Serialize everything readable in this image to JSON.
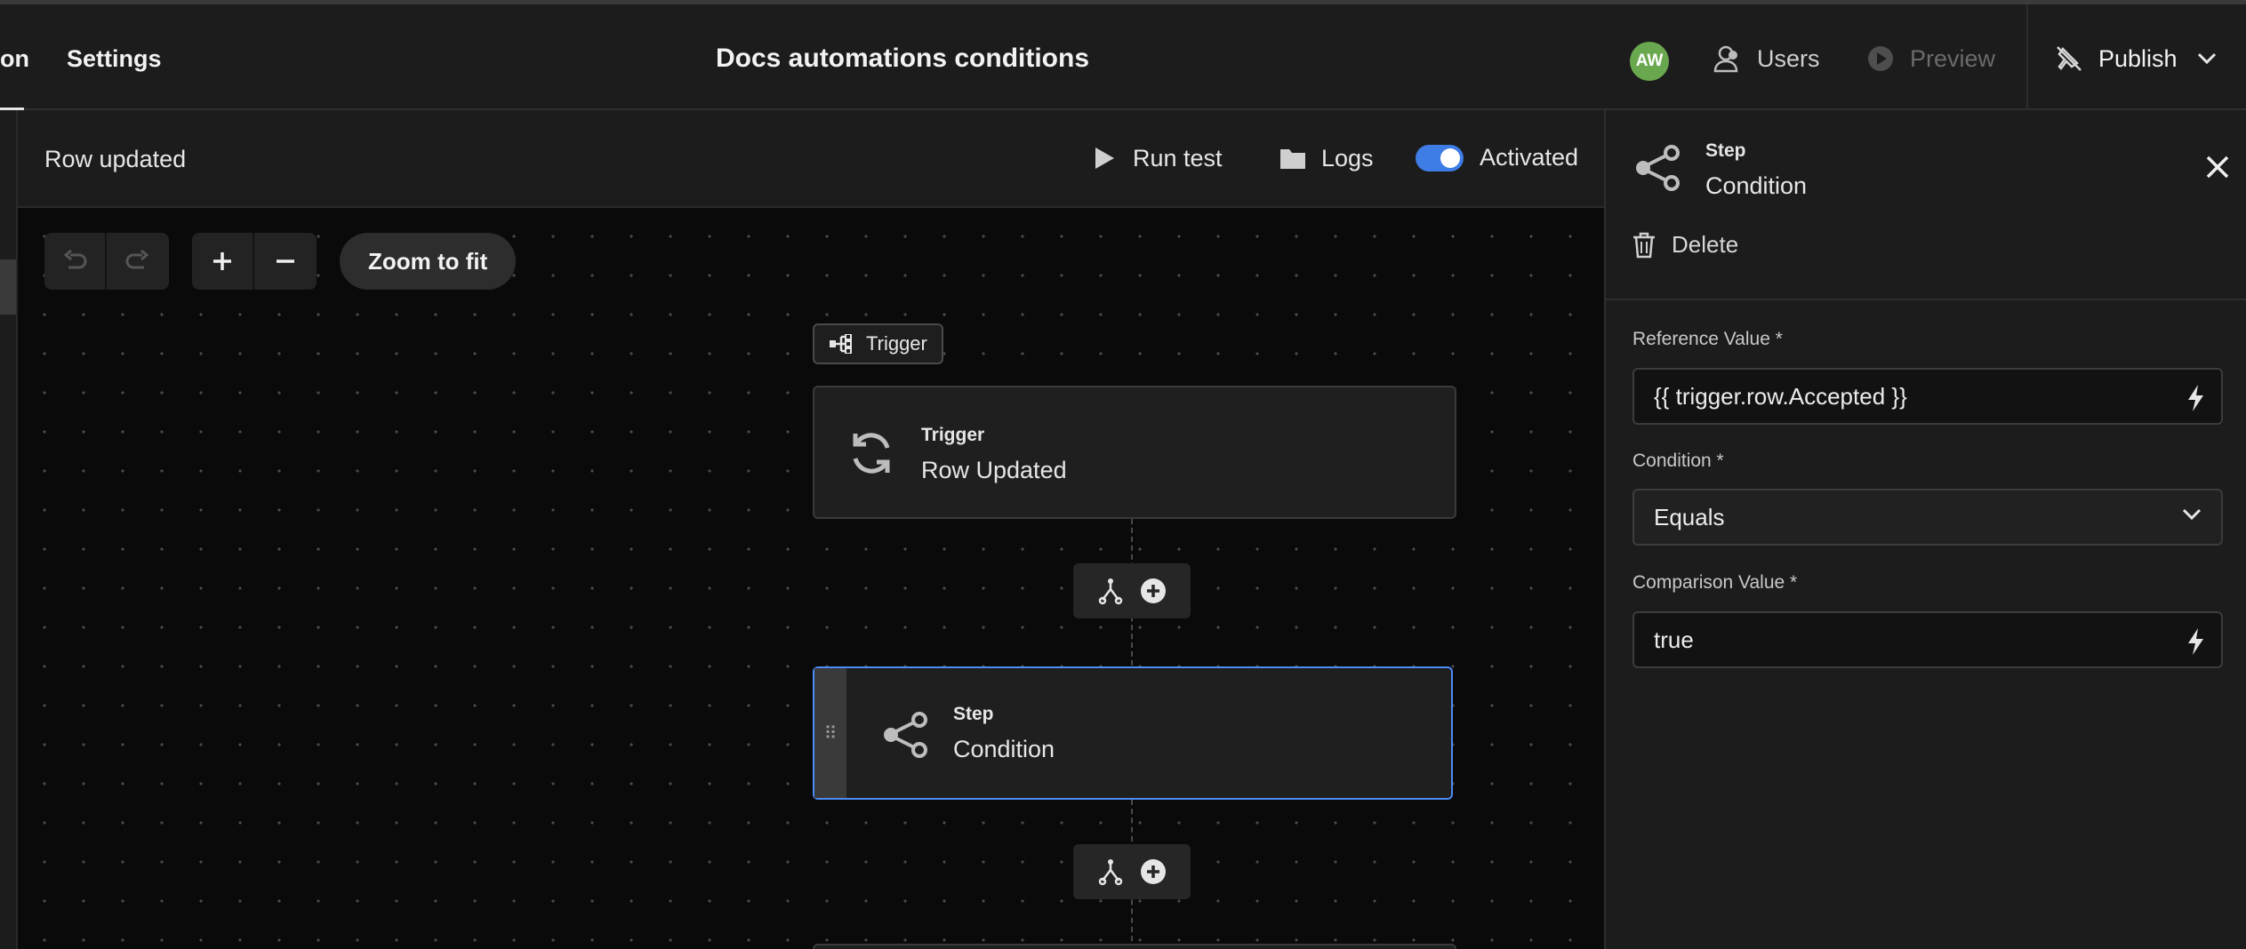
{
  "topbar": {
    "tab_partial": "on",
    "tab_settings": "Settings",
    "app_title": "Docs automations conditions",
    "avatar_initials": "AW",
    "users_label": "Users",
    "preview_label": "Preview",
    "publish_label": "Publish"
  },
  "automation": {
    "name": "Row updated",
    "run_test_label": "Run test",
    "logs_label": "Logs",
    "activated_label": "Activated"
  },
  "canvas": {
    "zoom_to_fit_label": "Zoom to fit",
    "trigger_tag_label": "Trigger",
    "trigger_node": {
      "kicker": "Trigger",
      "name": "Row Updated"
    },
    "step_node": {
      "kicker": "Step",
      "name": "Condition"
    }
  },
  "panel": {
    "kicker": "Step",
    "name": "Condition",
    "delete_label": "Delete",
    "reference_label": "Reference Value *",
    "reference_value": "{{ trigger.row.Accepted }}",
    "condition_label": "Condition *",
    "condition_value": "Equals",
    "comparison_label": "Comparison Value *",
    "comparison_value": "true"
  },
  "colors": {
    "accent": "#4c8bf5",
    "toggle_on": "#3e7ce6",
    "avatar_bg": "#6aa84f"
  }
}
